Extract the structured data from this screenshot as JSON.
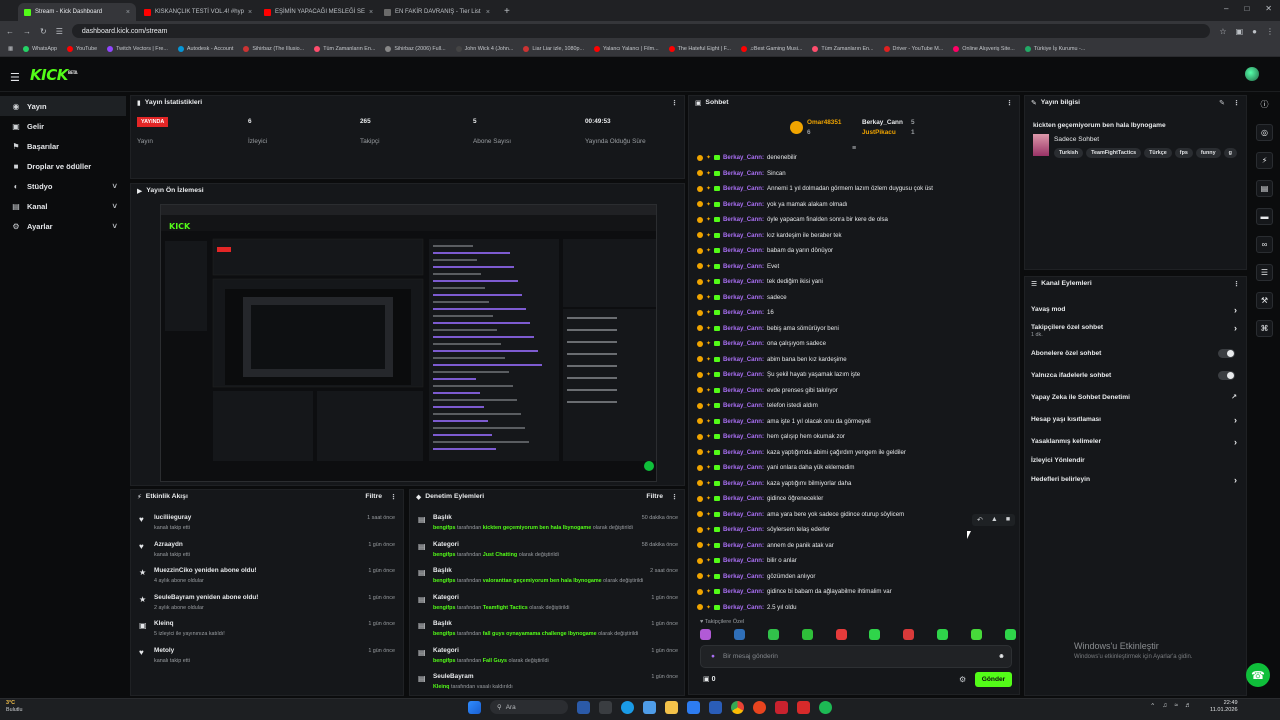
{
  "browser": {
    "tabs": [
      {
        "title": "Stream - Kick Dashboard",
        "color": "#53fc18",
        "active": true
      },
      {
        "title": "KISKANÇLIK TESTİ VOL.4! #hyp",
        "color": "#ff0000",
        "active": false
      },
      {
        "title": "EŞİMİN YAPACAĞI MESLEĞİ SE",
        "color": "#ff0000",
        "active": false
      },
      {
        "title": "EN FAKİR DAVRANIŞ - Tier List",
        "color": "#6a6a6a",
        "active": false
      }
    ],
    "url": "dashboard.kick.com/stream",
    "bookmarks": [
      "WhatsApp",
      "YouTube",
      "Twitch Vectors | Fre...",
      "Autodesk - Account",
      "Sihirbaz (The Illusio...",
      "Tüm Zamanların En...",
      "Sihirbaz (2006) Full...",
      "John Wick 4 (John...",
      "Liar Liar izle, 1080p...",
      "Yalancı Yalancı | Film...",
      "The Hateful Eight | F...",
      "♫Best Gaming Musi...",
      "Tüm Zamanların En...",
      "Driver - YouTube M...",
      "Online Alışveriş Site...",
      "Türkiye İş Kurumu -..."
    ]
  },
  "nav": {
    "items": [
      {
        "label": "Yayın",
        "icon": "broadcast-icon",
        "glyph": "◉",
        "active": true,
        "chevron": false
      },
      {
        "label": "Gelir",
        "icon": "wallet-icon",
        "glyph": "▣",
        "active": false,
        "chevron": false
      },
      {
        "label": "Başarılar",
        "icon": "trophy-icon",
        "glyph": "⚑",
        "active": false,
        "chevron": false
      },
      {
        "label": "Droplar ve ödüller",
        "icon": "gift-icon",
        "glyph": "■",
        "active": false,
        "chevron": false
      },
      {
        "label": "Stüdyo",
        "icon": "studio-icon",
        "glyph": "◐",
        "active": false,
        "chevron": true
      },
      {
        "label": "Kanal",
        "icon": "channel-icon",
        "glyph": "▤",
        "active": false,
        "chevron": true
      },
      {
        "label": "Ayarlar",
        "icon": "gear-icon",
        "glyph": "⚙",
        "active": false,
        "chevron": true
      }
    ]
  },
  "stats": {
    "title": "Yayın İstatistikleri",
    "live_badge": "YAYINDA",
    "cols": [
      {
        "value": "",
        "label": "Yayın"
      },
      {
        "value": "6",
        "label": "İzleyici"
      },
      {
        "value": "265",
        "label": "Takipçi"
      },
      {
        "value": "5",
        "label": "Abone Sayısı"
      },
      {
        "value": "00:49:53",
        "label": "Yayında Olduğu Süre"
      }
    ]
  },
  "preview": {
    "title": "Yayın Ön İzlemesi"
  },
  "activity": {
    "title": "Etkinlik Akışı",
    "filter": "Filtre",
    "rows": [
      {
        "icon": "heart-icon",
        "glyph": "♥",
        "title": "luciliieguray",
        "sub": "kanalı takip etti",
        "time": "1 saat önce"
      },
      {
        "icon": "heart-icon",
        "glyph": "♥",
        "title": "Azraaydn",
        "sub": "kanalı takip etti",
        "time": "1 gün önce"
      },
      {
        "icon": "star-icon",
        "glyph": "★",
        "title": "MuezzinCiko yeniden abone oldu!",
        "sub": "4 aylık abone oldular",
        "time": "1 gün önce"
      },
      {
        "icon": "star-icon",
        "glyph": "★",
        "title": "SeuleBayram yeniden abone oldu!",
        "sub": "2 aylık abone oldular",
        "time": "1 gün önce"
      },
      {
        "icon": "host-icon",
        "glyph": "▣",
        "title": "Kleinq",
        "sub": "5 izleyici ile yayınınıza katıldı!",
        "time": "1 gün önce"
      },
      {
        "icon": "heart-icon",
        "glyph": "♥",
        "title": "Metoly",
        "sub": "kanalı takip etti",
        "time": "1 gün önce"
      }
    ]
  },
  "moderation": {
    "title": "Denetim Eylemleri",
    "filter": "Filtre",
    "rows": [
      {
        "title": "Başlık",
        "actor": "bengifps",
        "mid": " tarafından ",
        "target": "kickten geçemiyorum ben hala lbynogame",
        "end": " olarak değiştirildi",
        "time": "50 dakika önce"
      },
      {
        "title": "Kategori",
        "actor": "bengifps",
        "mid": " tarafından ",
        "target": "Just Chatting",
        "end": " olarak değiştirildi",
        "time": "58 dakika önce"
      },
      {
        "title": "Başlık",
        "actor": "bengifps",
        "mid": " tarafından ",
        "target": "valoranttan geçemiyorum ben hala lbynogame",
        "end": " olarak değiştirildi",
        "time": "2 saat önce"
      },
      {
        "title": "Kategori",
        "actor": "bengifps",
        "mid": " tarafından ",
        "target": "Teamfight Tactics",
        "end": " olarak değiştirildi",
        "time": "1 gün önce"
      },
      {
        "title": "Başlık",
        "actor": "bengifps",
        "mid": " tarafından ",
        "target": "fall guys oynayamama challenge lbynogame",
        "end": " olarak değiştirildi",
        "time": "1 gün önce"
      },
      {
        "title": "Kategori",
        "actor": "bengifps",
        "mid": " tarafından ",
        "target": "Fall Guys",
        "end": " olarak değiştirildi",
        "time": "1 gün önce"
      },
      {
        "title": "SeuleBayram",
        "actor": "Kleinq",
        "mid": " tarafından ",
        "target": "",
        "end": "vasalı kaldırıldı",
        "time": "1 gün önce"
      }
    ]
  },
  "chat": {
    "title": "Sohbet",
    "pinned": [
      {
        "name": "Omar48351",
        "count": "6",
        "color": "#f0a400"
      },
      {
        "name": "Berkay_Cann",
        "count": "5",
        "color": "#e8eaec"
      },
      {
        "name": "JustPikacu",
        "count": "1",
        "color": "#f0a400"
      }
    ],
    "messages": [
      {
        "user": "Berkay_Cann:",
        "text": "denenebilir"
      },
      {
        "user": "Berkay_Cann:",
        "text": "Sincan"
      },
      {
        "user": "Berkay_Cann:",
        "text": "Annemi 1 yıl dolmadan görmem lazım özlem duygusu çok üst"
      },
      {
        "user": "Berkay_Cann:",
        "text": "yok ya mamak alakam olmadı"
      },
      {
        "user": "Berkay_Cann:",
        "text": "öyle yapacam finalden sonra bir kere de olsa"
      },
      {
        "user": "Berkay_Cann:",
        "text": "kız kardeşim ile beraber tek"
      },
      {
        "user": "Berkay_Cann:",
        "text": "babam da yarın dönüyor"
      },
      {
        "user": "Berkay_Cann:",
        "text": "Evet"
      },
      {
        "user": "Berkay_Cann:",
        "text": "tek dediğim ikisi yani"
      },
      {
        "user": "Berkay_Cann:",
        "text": "sadece"
      },
      {
        "user": "Berkay_Cann:",
        "text": "16"
      },
      {
        "user": "Berkay_Cann:",
        "text": "bebiş ama sömürüyor beni"
      },
      {
        "user": "Berkay_Cann:",
        "text": "ona çalışıyom sadece"
      },
      {
        "user": "Berkay_Cann:",
        "text": "abim bana ben kız kardeşime"
      },
      {
        "user": "Berkay_Cann:",
        "text": "Şu şekil hayatı yaşamak lazım işte"
      },
      {
        "user": "Berkay_Cann:",
        "text": "evde prenses gibi takılıyor"
      },
      {
        "user": "Berkay_Cann:",
        "text": "telefon istedi aldım"
      },
      {
        "user": "Berkay_Cann:",
        "text": "ama işte 1 yıl olacak onu da görmeyeli"
      },
      {
        "user": "Berkay_Cann:",
        "text": "hem çalışıp hem okumak zor"
      },
      {
        "user": "Berkay_Cann:",
        "text": "kaza yaptığımda abimi çağırdım yengem ile geldiler"
      },
      {
        "user": "Berkay_Cann:",
        "text": "yani onlara daha yük eklemedim"
      },
      {
        "user": "Berkay_Cann:",
        "text": "kaza yaptığımı bilmiyorlar daha"
      },
      {
        "user": "Berkay_Cann:",
        "text": "gidince öğrenecekler"
      },
      {
        "user": "Berkay_Cann:",
        "text": "ama yara bere yok sadece gidince oturup söylicem"
      },
      {
        "user": "Berkay_Cann:",
        "text": "söylersem telaş ederler"
      },
      {
        "user": "Berkay_Cann:",
        "text": "annem de panik atak var"
      },
      {
        "user": "Berkay_Cann:",
        "text": "bilir o anlar"
      },
      {
        "user": "Berkay_Cann:",
        "text": "gözümden anlıyor"
      },
      {
        "user": "Berkay_Cann:",
        "text": "gidince bi babam da ağlayabilme ihtimalim var"
      },
      {
        "user": "Berkay_Cann:",
        "text": "2.5 yıl oldu"
      }
    ],
    "followers_only": "Takipçilere Özel",
    "input_placeholder": "Bir mesaj gönderin",
    "points": "0",
    "send_label": "Gönder",
    "emote_colors": [
      "#b15ad6",
      "#2f6fb8",
      "#31c24a",
      "#2fbf3a",
      "#e63b3b",
      "#2fd44a",
      "#d93a3a",
      "#2fd44a",
      "#47d93a",
      "#2fd44a"
    ]
  },
  "streaminfo": {
    "title": "Yayın bilgisi",
    "stream_title": "kickten geçemiyorum ben hala lbynogame",
    "category": "Sadece Sohbet",
    "tags": [
      "Turkish",
      "TeamFightTactics",
      "Türkçe",
      "fps",
      "funny",
      "g"
    ]
  },
  "channelactions": {
    "title": "Kanal Eylemleri",
    "rows": [
      {
        "label": "Yavaş mod",
        "sub": "",
        "control": "chevron"
      },
      {
        "label": "Takipçilere özel sohbet",
        "sub": "1 dk.",
        "control": "chevron"
      },
      {
        "label": "Abonelere özel sohbet",
        "sub": "",
        "control": "toggle"
      },
      {
        "label": "Yalnızca ifadelerle sohbet",
        "sub": "",
        "control": "toggle"
      },
      {
        "label": "Yapay Zeka ile Sohbet Denetimi",
        "sub": "",
        "control": "external"
      },
      {
        "label": "Hesap yaşı kısıtlaması",
        "sub": "",
        "control": "chevron"
      },
      {
        "label": "Yasaklanmış kelimeler",
        "sub": "",
        "control": "chevron"
      },
      {
        "label": "İzleyici Yönlendir",
        "sub": "",
        "control": "none"
      },
      {
        "label": "Hedefleri belirleyin",
        "sub": "",
        "control": "chevron"
      }
    ]
  },
  "watermark": {
    "line1": "Windows'u Etkinleştir",
    "line2": "Windows'u etkinleştirmek için Ayarlar'a gidin."
  },
  "taskbar": {
    "weather_temp": "3°C",
    "weather_desc": "Bulutlu",
    "search": "Ara",
    "time": "22:49",
    "date": "11.01.2026"
  }
}
